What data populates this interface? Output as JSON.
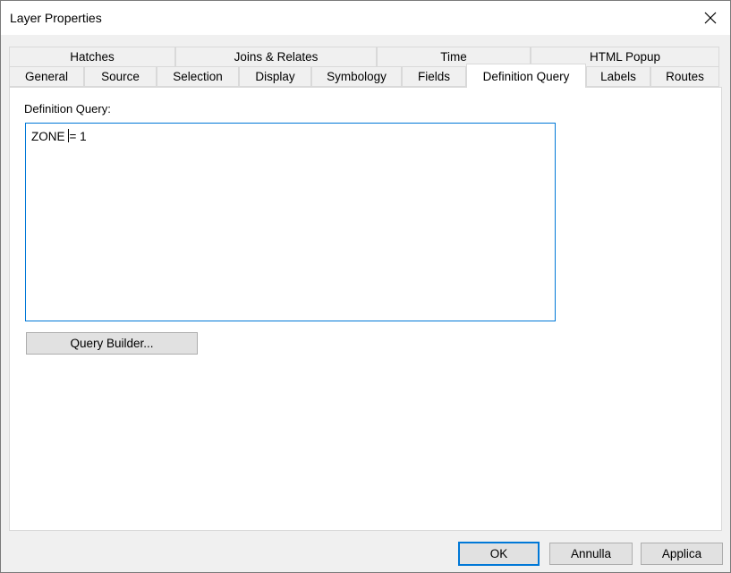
{
  "window": {
    "title": "Layer Properties"
  },
  "tabs_row1": [
    {
      "label": "Hatches"
    },
    {
      "label": "Joins & Relates"
    },
    {
      "label": "Time"
    },
    {
      "label": "HTML Popup"
    }
  ],
  "tabs_row2": [
    {
      "label": "General"
    },
    {
      "label": "Source"
    },
    {
      "label": "Selection"
    },
    {
      "label": "Display"
    },
    {
      "label": "Symbology"
    },
    {
      "label": "Fields"
    },
    {
      "label": "Definition Query",
      "active": true
    },
    {
      "label": "Labels"
    },
    {
      "label": "Routes"
    }
  ],
  "definition_query": {
    "label": "Definition Query:",
    "before_caret": "ZONE",
    "after_caret": "= 1",
    "query_builder_label": "Query Builder..."
  },
  "footer": {
    "ok_label": "OK",
    "cancel_label": "Annulla",
    "apply_label": "Applica"
  }
}
